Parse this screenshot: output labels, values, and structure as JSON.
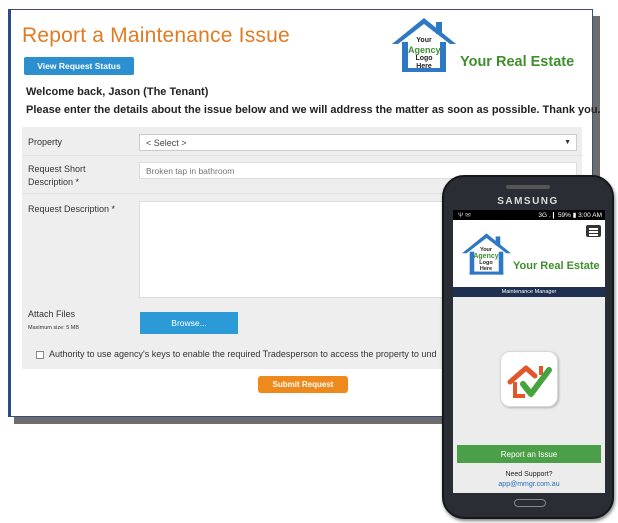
{
  "desktop": {
    "title": "Report a Maintenance Issue",
    "view_status_label": "View Request Status",
    "logo": {
      "line1": "Your",
      "line2": "Agency",
      "line3": "Logo Here"
    },
    "brand_name": "Your Real Estate",
    "welcome": "Welcome back, Jason (The Tenant)",
    "intro": "Please enter the details about the issue below and we will address the matter as soon as possible. Thank you.",
    "form": {
      "property_label": "Property",
      "property_value": "< Select >",
      "short_desc_label_1": "Request Short",
      "short_desc_label_2": "Description *",
      "short_desc_placeholder": "Broken tap in bathroom",
      "desc_label": "Request Description *",
      "attach_label": "Attach Files",
      "attach_max": "Maximum size: 5 MB",
      "browse_label": "Browse...",
      "authority_text": "Authority to use agency's keys to enable the required Tradesperson to access the property to und"
    },
    "submit_label": "Submit Request"
  },
  "phone": {
    "brand": "SAMSUNG",
    "status_left": "Ψ ✉",
    "status_right": "3G .❙ 59% ▮ 3:00 AM",
    "logo": {
      "line1": "Your",
      "line2": "Agency",
      "line3": "Logo Here"
    },
    "brand_name": "Your Real Estate",
    "bar_title": "Maintenance Manager",
    "report_label": "Report an Issue",
    "need_support": "Need Support?",
    "support_email": "app@mmgr.com.au"
  },
  "colors": {
    "title_orange": "#e07b22",
    "accent_blue": "#2c8fd0",
    "brand_green": "#3e8f2c",
    "submit_orange": "#ee8a1c",
    "report_green": "#4b9f48",
    "phone_bar_navy": "#1f3050"
  },
  "icons": [
    "house-logo-icon",
    "dropdown-arrow-icon",
    "menu-icon",
    "app-house-check-icon"
  ]
}
